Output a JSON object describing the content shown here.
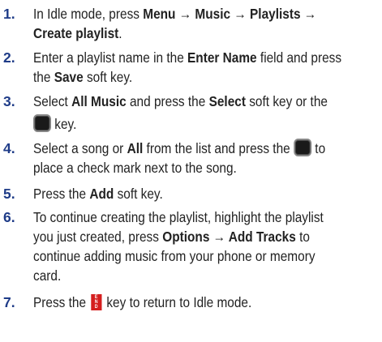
{
  "steps": [
    {
      "number": "1.",
      "lines": [
        {
          "t1": "In Idle mode, press ",
          "b1": "Menu → Music → Playlists →"
        },
        {
          "b1": "Create playlist",
          "t1": "."
        }
      ]
    },
    {
      "number": "2.",
      "lines": [
        {
          "t1": "Enter a playlist name in the ",
          "b1": "Enter Name",
          "t2": " field and press"
        },
        {
          "t1": "the ",
          "b1": "Save",
          "t2": " soft key."
        }
      ]
    },
    {
      "number": "3.",
      "lines": [
        {
          "t1": "Select ",
          "b1": "All Music",
          "t2": " and press the ",
          "b2": "Select",
          "t3": " soft key or the"
        },
        {
          "t1": " key."
        }
      ]
    },
    {
      "number": "4.",
      "lines": [
        {
          "t1": "Select a song or ",
          "b1": "All",
          "t2": " from the list and press the ",
          "t3": " to"
        },
        {
          "t1": "place a check mark next to the song."
        }
      ]
    },
    {
      "number": "5.",
      "lines": [
        {
          "t1": "Press the ",
          "b1": "Add",
          "t2": " soft key."
        }
      ]
    },
    {
      "number": "6.",
      "lines": [
        {
          "t1": "To continue creating the playlist, highlight the playlist"
        },
        {
          "t1": "you just created, press ",
          "b1": "Options → Add Tracks",
          "t2": " to"
        },
        {
          "t1": "continue adding music from your phone or memory"
        },
        {
          "t1": "card."
        }
      ]
    },
    {
      "number": "7.",
      "lines": [
        {
          "t1": "Press the ",
          "t2": " key to return to Idle mode."
        }
      ]
    }
  ],
  "icons": {
    "select_key": "select-key-icon",
    "end_key": "end-key-icon",
    "end_key_color": "#d51f1f"
  }
}
